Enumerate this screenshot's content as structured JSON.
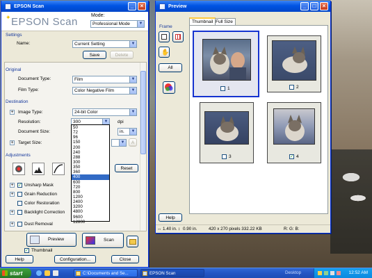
{
  "epson": {
    "title": "EPSON Scan",
    "logo_text": "EPSON Scan",
    "mode_label": "Mode:",
    "mode_value": "Professional Mode",
    "settings_header": "Settings",
    "name_label": "Name:",
    "name_value": "Current Setting",
    "save_label": "Save",
    "delete_label": "Delete",
    "original_header": "Original",
    "document_type_label": "Document Type:",
    "document_type_value": "Film",
    "film_type_label": "Film Type:",
    "film_type_value": "Color Negative Film",
    "destination_header": "Destination",
    "image_type_label": "Image Type:",
    "image_type_value": "24-bit Color",
    "resolution_label": "Resolution:",
    "resolution_value": "300",
    "resolution_unit": "dpi",
    "document_size_label": "Document Size:",
    "document_size_unit": "in.",
    "target_size_label": "Target Size:",
    "adjustments_header": "Adjustments",
    "reset_label": "Reset",
    "unsharp_label": "Unsharp Mask",
    "grain_label": "Grain Reduction",
    "color_restoration_label": "Color Restoration",
    "backlight_label": "Backlight Correction",
    "dust_label": "Dust Removal",
    "preview_label": "Preview",
    "scan_label": "Scan",
    "thumbnail_label": "Thumbnail",
    "help_label": "Help",
    "configuration_label": "Configuration...",
    "close_label": "Close",
    "resolution_options": [
      "50",
      "72",
      "96",
      "150",
      "200",
      "240",
      "288",
      "300",
      "350",
      "360",
      "400",
      "600",
      "720",
      "800",
      "1200",
      "2400",
      "3200",
      "4800",
      "9600",
      "12800"
    ],
    "resolution_highlighted": "400"
  },
  "preview": {
    "title": "Preview",
    "frame_label": "Frame",
    "all_label": "All",
    "help_label": "Help",
    "tabs": [
      "Thumbnail",
      "Full Size"
    ],
    "thumbnails": [
      {
        "num": "1",
        "checked": false
      },
      {
        "num": "2",
        "checked": false
      },
      {
        "num": "3",
        "checked": false
      },
      {
        "num": "4",
        "checked": true
      }
    ],
    "status_width": "1.40 in.",
    "status_height": "0.90 in.",
    "status_pixels": "420 x 270 pixels 332.22 KB",
    "status_rgb": "R: G: B:"
  },
  "taskbar": {
    "start_label": "start",
    "task1": "C:\\Documents and Se...",
    "task2": "EPSON Scan",
    "tray_desktop": "Desktop",
    "clock": "12:52 AM"
  }
}
